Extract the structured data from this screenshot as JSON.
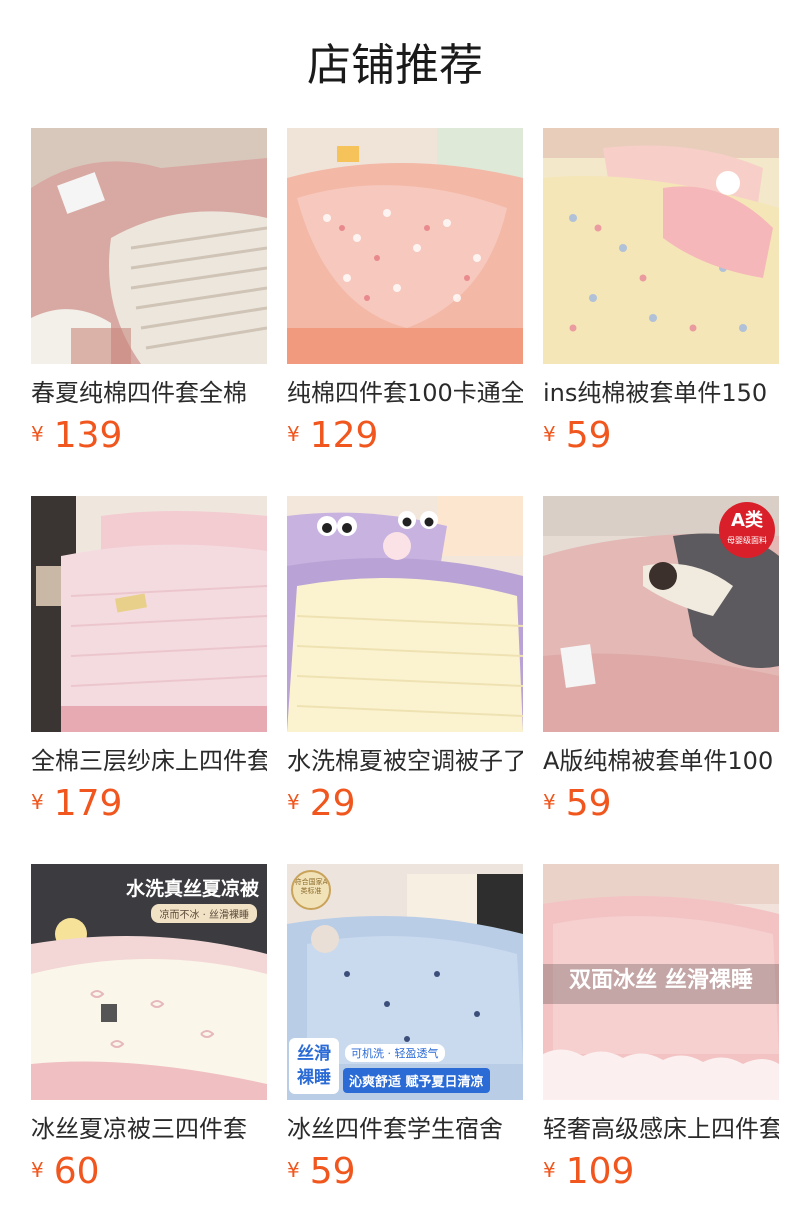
{
  "section": {
    "title": "店铺推荐"
  },
  "currency_symbol": "¥",
  "products": [
    {
      "name": "春夏纯棉四件套全棉",
      "price": "139",
      "image_icon": "bedding-image"
    },
    {
      "name": "纯棉四件套100卡通全",
      "price": "129",
      "image_icon": "bedding-image"
    },
    {
      "name": "ins纯棉被套单件150",
      "price": "59",
      "image_icon": "bedding-image"
    },
    {
      "name": "全棉三层纱床上四件套",
      "price": "179",
      "image_icon": "bedding-image"
    },
    {
      "name": "水洗棉夏被空调被子了",
      "price": "29",
      "image_icon": "bedding-image"
    },
    {
      "name": "A版纯棉被套单件100",
      "price": "59",
      "image_icon": "bedding-image",
      "badge": {
        "main": "A类",
        "sub": "母婴级面料"
      }
    },
    {
      "name": "冰丝夏凉被三四件套",
      "price": "60",
      "image_icon": "bedding-image",
      "overlay": {
        "headline": "水洗真丝夏凉被",
        "tagline": "凉而不冰 · 丝滑裸睡"
      }
    },
    {
      "name": "冰丝四件套学生宿舍",
      "price": "59",
      "image_icon": "bedding-image",
      "overlay": {
        "stamp": "符合国家A类标准",
        "badge_line1": "丝滑",
        "badge_line2": "裸睡",
        "tag1": "可机洗 · 轻盈透气",
        "tag2": "沁爽舒适 赋予夏日清凉"
      }
    },
    {
      "name": "轻奢高级感床上四件套",
      "price": "109",
      "image_icon": "bedding-image",
      "overlay": {
        "banner": "双面冰丝 丝滑裸睡"
      }
    }
  ],
  "colors": {
    "price": "#f0561d",
    "text": "#2a2a2a"
  }
}
